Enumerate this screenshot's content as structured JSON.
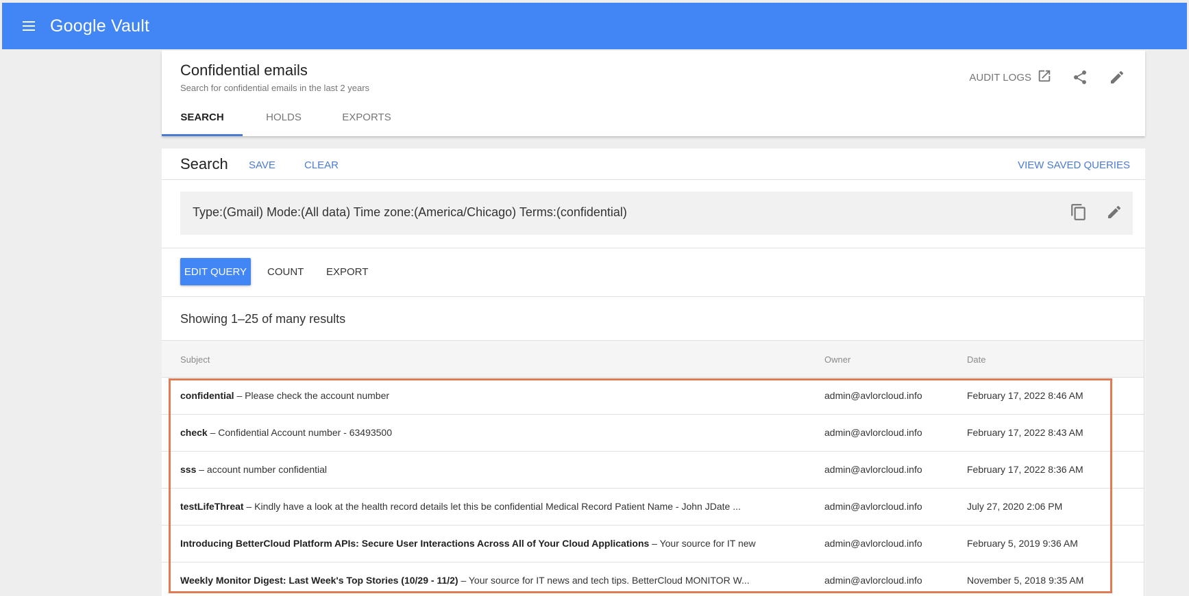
{
  "app": {
    "title": "Google Vault",
    "brand_color": "#4285f4",
    "accent_color": "#4a7bd0",
    "highlight_color": "#e07b53"
  },
  "matter": {
    "title": "Confidential emails",
    "description": "Search for confidential emails in the last 2 years",
    "audit_logs_label": "AUDIT LOGS",
    "icons": [
      "open-in-new-icon",
      "share-icon",
      "edit-icon"
    ],
    "tabs": [
      {
        "label": "SEARCH",
        "active": true
      },
      {
        "label": "HOLDS",
        "active": false
      },
      {
        "label": "EXPORTS",
        "active": false
      }
    ]
  },
  "search": {
    "title": "Search",
    "save_label": "SAVE",
    "clear_label": "CLEAR",
    "view_saved_label": "VIEW SAVED QUERIES",
    "query_summary": "Type:(Gmail) Mode:(All data) Time zone:(America/Chicago) Terms:(confidential)",
    "query_icons": [
      "copy-icon",
      "edit-icon"
    ],
    "edit_query_label": "EDIT QUERY",
    "count_label": "COUNT",
    "export_label": "EXPORT"
  },
  "results": {
    "summary": "Showing 1–25 of many results",
    "columns": [
      "Subject",
      "Owner",
      "Date"
    ],
    "rows": [
      {
        "subject": "confidential",
        "snippet": " – Please check the account number",
        "owner": "admin@avlorcloud.info",
        "date": "February 17, 2022 8:46 AM"
      },
      {
        "subject": "check",
        "snippet": " – Confidential Account number - 63493500",
        "owner": "admin@avlorcloud.info",
        "date": "February 17, 2022 8:43 AM"
      },
      {
        "subject": "sss",
        "snippet": " – account number confidential",
        "owner": "admin@avlorcloud.info",
        "date": "February 17, 2022 8:36 AM"
      },
      {
        "subject": "testLifeThreat",
        "snippet": " – Kindly have a look at the health record details let this be confidential Medical Record Patient Name - John JDate ...",
        "owner": "admin@avlorcloud.info",
        "date": "July 27, 2020 2:06 PM"
      },
      {
        "subject": "Introducing BetterCloud Platform APIs: Secure User Interactions Across All of Your Cloud Applications",
        "snippet": " – Your source for IT new...",
        "owner": "admin@avlorcloud.info",
        "date": "February 5, 2019 9:36 AM"
      },
      {
        "subject": "Weekly Monitor Digest: Last Week's Top Stories (10/29 - 11/2)",
        "snippet": " – Your source for IT news and tech tips. BetterCloud MONITOR W...",
        "owner": "admin@avlorcloud.info",
        "date": "November 5, 2018 9:35 AM"
      }
    ]
  }
}
